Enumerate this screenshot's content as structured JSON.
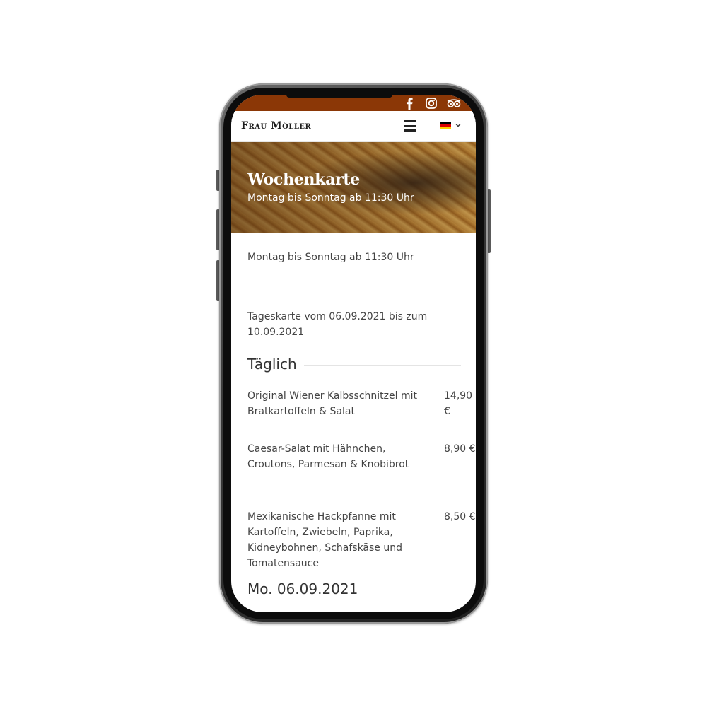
{
  "topbar": {
    "color": "#8b3706",
    "icons": [
      "facebook-icon",
      "instagram-icon",
      "tripadvisor-icon"
    ]
  },
  "navbar": {
    "logo": "Frau Möller",
    "menu_icon": "hamburger-icon",
    "language_icon": "german-flag-icon",
    "language_chevron": "chevron-down-icon"
  },
  "hero": {
    "title": "Wochenkarte",
    "subtitle": "Montag bis Sonntag ab 11:30 Uhr"
  },
  "content": {
    "hours": "Montag bis Sonntag ab 11:30 Uhr",
    "date_range": "Tageskarte vom 06.09.2021 bis zum 10.09.2021",
    "sections": [
      {
        "title": "Täglich",
        "items": [
          {
            "name": "Original Wiener Kalbsschnitzel mit Bratkartoffeln & Salat",
            "price": "14,90 €"
          },
          {
            "name": "Caesar-Salat mit Hähnchen, Croutons, Parmesan & Knobibrot",
            "price": "8,90 €"
          },
          {
            "name": "Mexikanische Hackpfanne mit Kartoffeln, Zwiebeln, Paprika, Kidneybohnen, Schafskäse und Tomatensauce",
            "price": "8,50 €"
          }
        ]
      },
      {
        "title": "Mo. 06.09.2021",
        "items": []
      }
    ]
  }
}
